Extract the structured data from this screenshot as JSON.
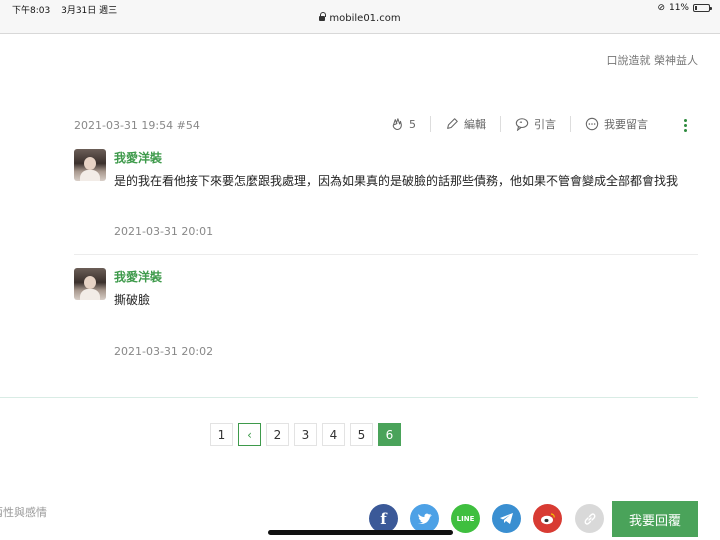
{
  "status_bar": {
    "time": "下午8:03",
    "date": "3月31日 週三",
    "battery": "11%",
    "url": "mobile01.com"
  },
  "tags": "口說造就 榮神益人",
  "post": {
    "meta": "2021-03-31 19:54 #54",
    "like_count": "5",
    "edit_label": "編輯",
    "quote_label": "引言",
    "comment_label": "我要留言"
  },
  "comments": [
    {
      "author": "我愛洋裝",
      "text": "是的我在看他接下來要怎麼跟我處理，因為如果真的是破臉的話那些債務，他如果不管會變成全部都會找我",
      "time": "2021-03-31 20:01"
    },
    {
      "author": "我愛洋裝",
      "text": "撕破臉",
      "time": "2021-03-31 20:02"
    }
  ],
  "pagination": {
    "pages": [
      "1",
      "2",
      "3",
      "4",
      "5",
      "6"
    ],
    "prev_symbol": "‹",
    "current": "6"
  },
  "footer_text": "兩性與感情",
  "share": [
    {
      "name": "facebook",
      "glyph": "f",
      "color": "#3b5998"
    },
    {
      "name": "twitter",
      "glyph": "🐦",
      "color": "#4da1e6"
    },
    {
      "name": "line",
      "glyph": "LINE",
      "color": "#3fbf3f"
    },
    {
      "name": "telegram",
      "glyph": "➤",
      "color": "#3a8fd1"
    },
    {
      "name": "weibo",
      "glyph": "微",
      "color": "#d83b33"
    },
    {
      "name": "link",
      "glyph": "🔗",
      "color": "#d9d9d9"
    }
  ],
  "reply_button": "我要回覆",
  "colors": {
    "accent": "#4aa35a",
    "author": "#3e9a4b"
  }
}
